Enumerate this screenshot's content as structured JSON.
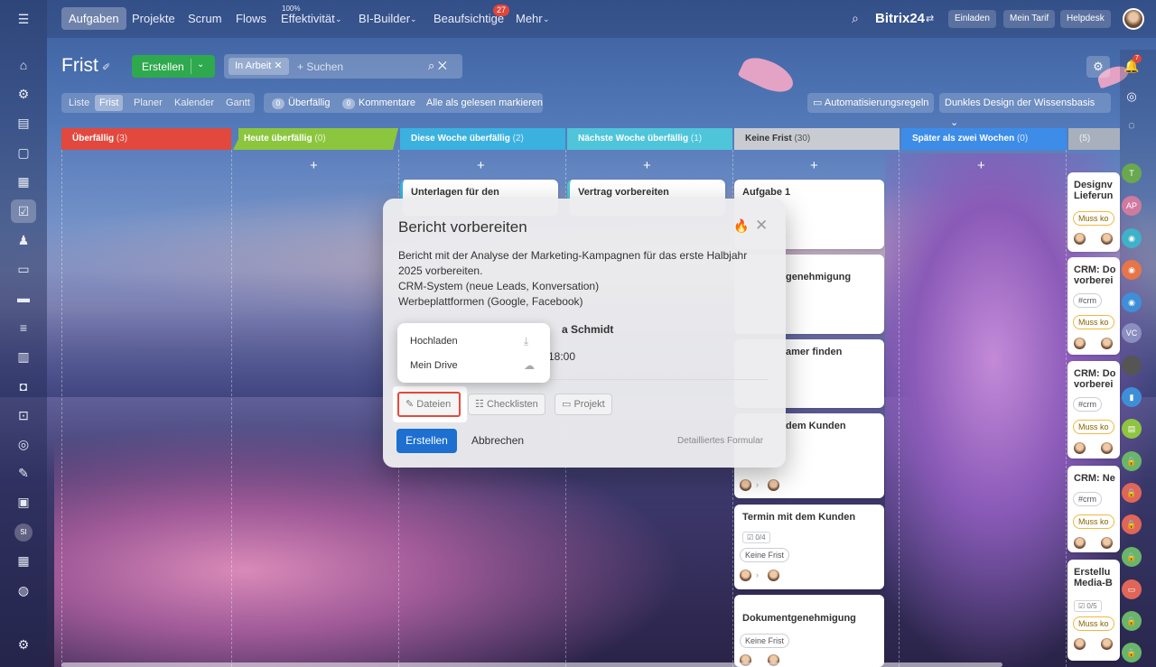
{
  "topnav": {
    "items": [
      "Aufgaben",
      "Projekte",
      "Scrum",
      "Flows",
      "Effektivität",
      "BI-Builder",
      "Beaufsichtige",
      "Mehr"
    ],
    "effektivitaet_sup": "100%",
    "beaufsichtige_badge": "27",
    "brand": "Bitrix24",
    "invite": "Einladen",
    "plan": "Mein Tarif",
    "helpdesk": "Helpdesk"
  },
  "header": {
    "title": "Frist",
    "create_label": "Erstellen",
    "filter_chip": "In Arbeit",
    "search_placeholder": "+ Suchen"
  },
  "views": {
    "tabs": [
      "Liste",
      "Frist",
      "Planer",
      "Kalender",
      "Gantt"
    ],
    "active": "Frist"
  },
  "counters": {
    "overdue_count": "0",
    "overdue_label": "Überfällig",
    "comments_count": "0",
    "comments_label": "Kommentare",
    "mark_all": "Alle als gelesen markieren"
  },
  "right_buttons": {
    "automation": "Automatisierungsregeln",
    "dark_design": "Dunkles Design der Wissensbasis"
  },
  "columns": [
    {
      "name": "Überfällig",
      "count": "(3)",
      "color": "#e2483d"
    },
    {
      "name": "Heute überfällig",
      "count": "(0)",
      "color": "#8cc63e"
    },
    {
      "name": "Diese Woche überfällig",
      "count": "(2)",
      "color": "#3bb1e0"
    },
    {
      "name": "Nächste Woche überfällig",
      "count": "(1)",
      "color": "#4fc5da"
    },
    {
      "name": "Keine Frist",
      "count": "(30)",
      "color": "#c8ccd2"
    },
    {
      "name": "Später als zwei Wochen",
      "count": "(0)",
      "color": "#3c8ce8"
    },
    {
      "name": "",
      "count": "(5)",
      "color": "#a9b0bd"
    }
  ],
  "cards": {
    "c3_title": "Unterlagen für den",
    "c4_title": "Vertrag vorbereiten",
    "k1_title": "Aufgabe 1",
    "k2_title": "genehmigung",
    "k3_title": "amer finden",
    "k4_title": "dem Kunden",
    "k5_title": "Termin mit dem Kunden",
    "k5_check": "0/4",
    "k5_tag": "Keine Frist",
    "k6_title": "Dokumentgenehmigung",
    "k6_tag": "Keine Frist",
    "r1_title": "Designv",
    "r1_title2": "Lieferun",
    "r1_tag": "Muss ko",
    "r2_title": "CRM: Do",
    "r2_title2": "vorberei",
    "r2_tag1": "#crm",
    "r2_tag2": "Muss ko",
    "r3_title": "CRM: Do",
    "r3_title2": "vorberei",
    "r3_tag1": "#crm",
    "r3_tag2": "Muss ko",
    "r4_title": "CRM: Ne",
    "r4_tag1": "#crm",
    "r4_tag2": "Muss ko",
    "r5_title": "Erstellu",
    "r5_title2": "Media-B",
    "r5_check": "0/5",
    "r5_tag": "Muss ko"
  },
  "modal": {
    "title": "Bericht vorbereiten",
    "desc_line1": "Bericht mit der Analyse der Marketing-Kampagnen für das erste Halbjahr",
    "desc_line2": "2025 vorbereiten.",
    "desc_line3": "CRM-System (neue Leads, Konversation)",
    "desc_line4": "Werbeplattformen (Google, Facebook)",
    "responsible_partial": "a Schmidt",
    "time_partial": "18:00",
    "tool_files": "Dateien",
    "tool_checklists": "Checklisten",
    "tool_project": "Projekt",
    "create": "Erstellen",
    "cancel": "Abbrechen",
    "detailed": "Detailliertes Formular"
  },
  "dropdown": {
    "upload": "Hochladen",
    "drive": "Mein Drive"
  },
  "right_rail": {
    "t": "T",
    "ap": "AP",
    "vc": "VC"
  },
  "left_rail": {
    "si": "SI"
  },
  "colors": {
    "accent_green": "#2fa94e",
    "accent_blue": "#1d6fd0",
    "highlight_red": "#e84a3a"
  }
}
